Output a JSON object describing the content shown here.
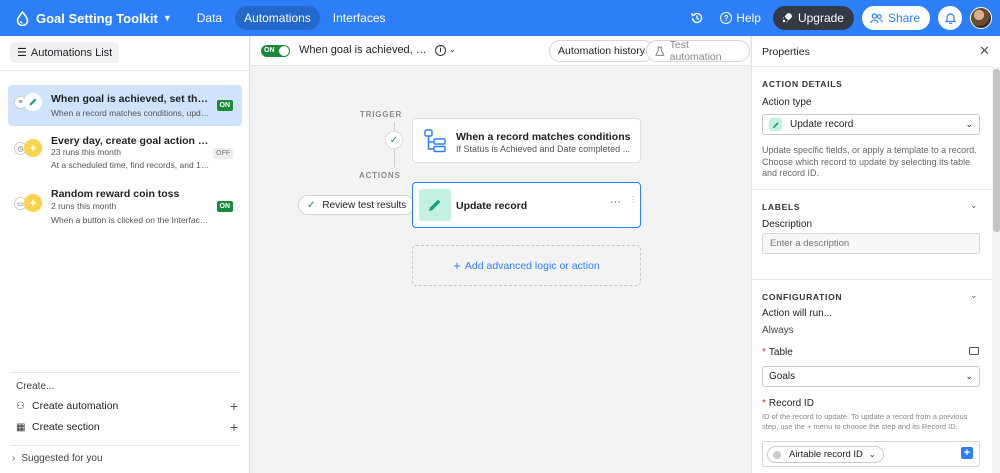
{
  "app": {
    "title": "Goal Setting Toolkit"
  },
  "nav": {
    "items": [
      "Data",
      "Automations",
      "Interfaces"
    ],
    "active": "Automations"
  },
  "topbar": {
    "help": "Help",
    "upgrade": "Upgrade",
    "share": "Share"
  },
  "sidebar": {
    "list_button": "Automations List",
    "automations": [
      {
        "title": "When goal is achieved, set the date ...",
        "subtitle": "When a record matches conditions, update ...",
        "status": "ON",
        "selected": true,
        "icon": "pencil-icon"
      },
      {
        "title": "Every day, create goal action tracking...",
        "subtitle": "23 runs this month",
        "detail": "At a scheduled time, find records, and 1 mor...",
        "status": "OFF",
        "selected": false,
        "icon": "plus-icon"
      },
      {
        "title": "Random reward coin toss",
        "subtitle": "2 runs this month",
        "detail": "When a button is clicked on the Interface, th...",
        "status": "ON",
        "selected": false,
        "icon": "plus-icon"
      }
    ],
    "create_label": "Create...",
    "create_automation": "Create automation",
    "create_section": "Create section",
    "suggested": "Suggested for you"
  },
  "center": {
    "toggle_label": "ON",
    "title": "When goal is achieved, set th...",
    "automation_history": "Automation history",
    "test_automation": "Test automation",
    "trigger_label": "TRIGGER",
    "actions_label": "ACTIONS",
    "trigger_card": {
      "title": "When a record matches conditions",
      "subtitle": "If Status is Achieved and Date completed ..."
    },
    "action_card": {
      "title": "Update record"
    },
    "review_button": "Review test results",
    "add_logic": "Add advanced logic or action"
  },
  "properties": {
    "title": "Properties",
    "action_details": "ACTION DETAILS",
    "action_type_label": "Action type",
    "action_type_value": "Update record",
    "action_type_desc": "Update specific fields, or apply a template to a record. Choose which record to update by selecting its table and record ID.",
    "labels": "LABELS",
    "description_label": "Description",
    "description_placeholder": "Enter a description",
    "configuration": "CONFIGURATION",
    "action_will_run": "Action will run...",
    "always": "Always",
    "table_label": "Table",
    "table_value": "Goals",
    "record_id_label": "Record ID",
    "record_id_help": "ID of the record to update. To update a record from a previous step, use the + menu to choose the step and its Record ID.",
    "record_id_value": "Airtable record ID"
  },
  "colors": {
    "brand": "#2d7ff9",
    "on": "#1a8a3a",
    "selected": "#cfe4fb",
    "action_tint": "#c4f0e3"
  }
}
